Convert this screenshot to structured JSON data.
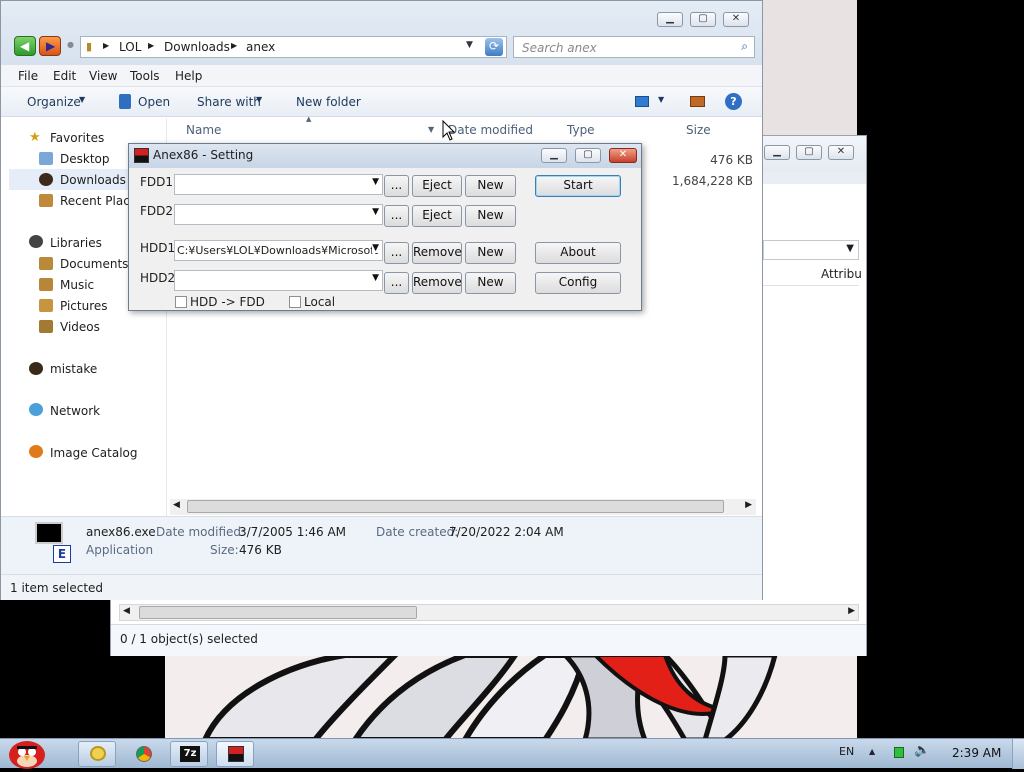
{
  "explorer": {
    "breadcrumb": [
      "LOL",
      "Downloads",
      "anex"
    ],
    "search_placeholder": "Search anex",
    "menu": [
      "File",
      "Edit",
      "View",
      "Tools",
      "Help"
    ],
    "toolbar": {
      "organize": "Organize",
      "open": "Open",
      "share_with": "Share with",
      "new_folder": "New folder"
    },
    "nav": {
      "favorites": "Favorites",
      "desktop": "Desktop",
      "downloads": "Downloads",
      "recent": "Recent Places",
      "libraries": "Libraries",
      "documents": "Documents",
      "music": "Music",
      "pictures": "Pictures",
      "videos": "Videos",
      "mistake": "mistake",
      "network": "Network",
      "image_catalog": "Image Catalog"
    },
    "columns": {
      "name": "Name",
      "date_modified": "Date modified",
      "type": "Type",
      "size": "Size"
    },
    "file_sizes": [
      "476 KB",
      "1,684,228 KB"
    ],
    "details": {
      "filename": "anex86.exe",
      "filetype": "Application",
      "date_modified_label": "Date modified:",
      "date_modified": "3/7/2005 1:46 AM",
      "size_label": "Size:",
      "size": "476 KB",
      "date_created_label": "Date created:",
      "date_created": "7/20/2022 2:04 AM",
      "icon_letter": "E"
    },
    "status": "1 item selected"
  },
  "back_window": {
    "column": "Attribu",
    "status": "0 / 1 object(s) selected"
  },
  "dialog": {
    "title": "Anex86 - Setting",
    "fdd1_label": "FDD1",
    "fdd2_label": "FDD2",
    "hdd1_label": "HDD1",
    "hdd2_label": "HDD2",
    "fdd1_value": "",
    "fdd2_value": "",
    "hdd1_value": "C:¥Users¥LOL¥Downloads¥Microsoft",
    "hdd2_value": "",
    "browse": "...",
    "eject": "Eject",
    "new": "New",
    "remove": "Remove",
    "start": "Start",
    "about": "About",
    "config": "Config",
    "hdd_to_fdd": "HDD -> FDD",
    "local": "Local"
  },
  "taskbar": {
    "language": "EN",
    "clock": "2:39 AM"
  }
}
